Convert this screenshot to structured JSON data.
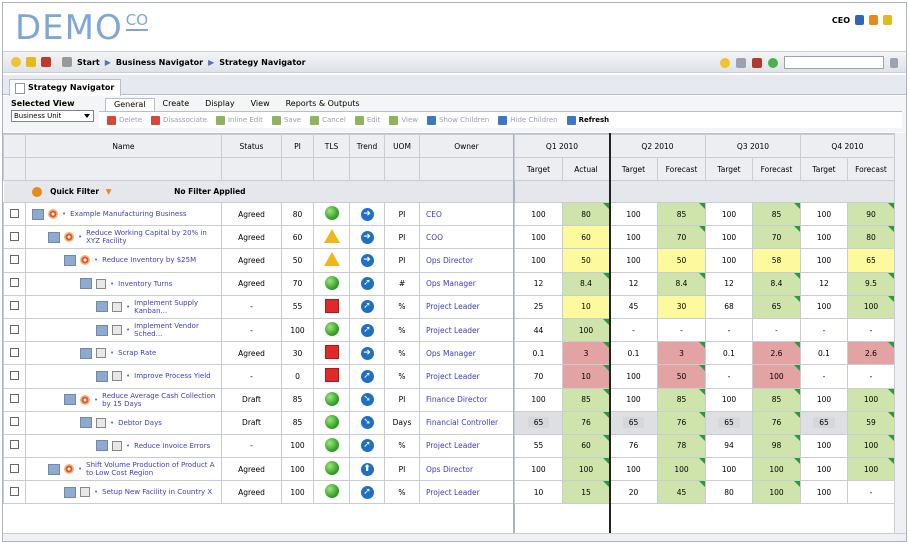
{
  "logo": {
    "main": "DEMO",
    "sub": "CO"
  },
  "user": {
    "name": "CEO",
    "icon_colors": [
      "#2e66b5",
      "#e58a1c",
      "#e5b81c"
    ]
  },
  "nav": {
    "start": "Start",
    "crumbs": [
      "Business Navigator",
      "Strategy Navigator"
    ]
  },
  "tab": {
    "label": "Strategy Navigator"
  },
  "view": {
    "label": "Selected View",
    "value": "Business Unit"
  },
  "menu": [
    "General",
    "Create",
    "Display",
    "View",
    "Reports & Outputs"
  ],
  "actions": [
    {
      "label": "Delete",
      "enabled": false,
      "color": "#d34a3d"
    },
    {
      "label": "Disassociate",
      "enabled": false,
      "color": "#d34a3d"
    },
    {
      "label": "Inline Edit",
      "enabled": false,
      "color": "#8fb45e"
    },
    {
      "label": "Save",
      "enabled": false,
      "color": "#8fb45e"
    },
    {
      "label": "Cancel",
      "enabled": false,
      "color": "#8fb45e"
    },
    {
      "label": "Edit",
      "enabled": false,
      "color": "#8fb45e"
    },
    {
      "label": "View",
      "enabled": false,
      "color": "#8fb45e"
    },
    {
      "label": "Show Children",
      "enabled": false,
      "color": "#3d78c7"
    },
    {
      "label": "Hide Children",
      "enabled": false,
      "color": "#3d78c7"
    },
    {
      "label": "Refresh",
      "enabled": true,
      "color": "#3d78c7"
    }
  ],
  "columns": [
    "Name",
    "Status",
    "PI",
    "TLS",
    "Trend",
    "UOM",
    "Owner"
  ],
  "filter": {
    "label": "Quick Filter",
    "status": "No Filter Applied"
  },
  "quarters": [
    "Q1 2010",
    "Q2 2010",
    "Q3 2010",
    "Q4 2010"
  ],
  "subheaders": [
    "Target",
    "Actual",
    "Target",
    "Forecast",
    "Target",
    "Forecast",
    "Target",
    "Forecast"
  ],
  "rows": [
    {
      "name": "Example Manufacturing Business",
      "depth": 0,
      "kind": "obj",
      "status": "Agreed",
      "pi": "80",
      "tls": "green",
      "trend": "right",
      "uom": "PI",
      "owner": "CEO",
      "vals": [
        [
          "100",
          ""
        ],
        [
          "80",
          "g"
        ],
        [
          "100",
          ""
        ],
        [
          "85",
          "g"
        ],
        [
          "100",
          ""
        ],
        [
          "85",
          "g"
        ],
        [
          "100",
          ""
        ],
        [
          "90",
          "g"
        ]
      ]
    },
    {
      "name": "Reduce Working Capital by 20% in XYZ Facility",
      "depth": 1,
      "kind": "obj",
      "status": "Agreed",
      "pi": "60",
      "tls": "warn",
      "trend": "right",
      "uom": "PI",
      "owner": "COO",
      "vals": [
        [
          "100",
          ""
        ],
        [
          "60",
          "y"
        ],
        [
          "100",
          ""
        ],
        [
          "70",
          "g"
        ],
        [
          "100",
          ""
        ],
        [
          "70",
          "g"
        ],
        [
          "100",
          ""
        ],
        [
          "80",
          "g"
        ]
      ]
    },
    {
      "name": "Reduce Inventory by $25M",
      "depth": 2,
      "kind": "obj",
      "status": "Agreed",
      "pi": "50",
      "tls": "warn",
      "trend": "right",
      "uom": "PI",
      "owner": "Ops Director",
      "vals": [
        [
          "100",
          ""
        ],
        [
          "50",
          "y"
        ],
        [
          "100",
          ""
        ],
        [
          "50",
          "y"
        ],
        [
          "100",
          ""
        ],
        [
          "58",
          "y"
        ],
        [
          "100",
          ""
        ],
        [
          "65",
          "y"
        ]
      ]
    },
    {
      "name": "Inventory Turns",
      "depth": 3,
      "kind": "kpi",
      "status": "Agreed",
      "pi": "70",
      "tls": "green",
      "trend": "up",
      "uom": "#",
      "owner": "Ops Manager",
      "vals": [
        [
          "12",
          ""
        ],
        [
          "8.4",
          "g"
        ],
        [
          "12",
          ""
        ],
        [
          "8.4",
          "g"
        ],
        [
          "12",
          ""
        ],
        [
          "8.4",
          "g"
        ],
        [
          "12",
          ""
        ],
        [
          "9.5",
          "g"
        ]
      ]
    },
    {
      "name": "Implement Supply Kanban...",
      "depth": 4,
      "kind": "kpi",
      "status": "-",
      "pi": "55",
      "tls": "red",
      "trend": "up",
      "uom": "%",
      "owner": "Project Leader",
      "vals": [
        [
          "25",
          ""
        ],
        [
          "10",
          "y"
        ],
        [
          "45",
          ""
        ],
        [
          "30",
          "y"
        ],
        [
          "68",
          ""
        ],
        [
          "65",
          "g"
        ],
        [
          "100",
          ""
        ],
        [
          "100",
          "g"
        ]
      ]
    },
    {
      "name": "Implement Vendor Sched...",
      "depth": 4,
      "kind": "kpi",
      "status": "-",
      "pi": "100",
      "tls": "green",
      "trend": "up",
      "uom": "%",
      "owner": "Project Leader",
      "vals": [
        [
          "44",
          ""
        ],
        [
          "100",
          "g"
        ],
        [
          "-",
          ""
        ],
        [
          "-",
          ""
        ],
        [
          "-",
          ""
        ],
        [
          "-",
          ""
        ],
        [
          "-",
          ""
        ],
        [
          "-",
          ""
        ]
      ]
    },
    {
      "name": "Scrap Rate",
      "depth": 3,
      "kind": "kpi",
      "status": "Agreed",
      "pi": "30",
      "tls": "red",
      "trend": "right",
      "uom": "%",
      "owner": "Ops Manager",
      "vals": [
        [
          "0.1",
          ""
        ],
        [
          "3",
          "r"
        ],
        [
          "0.1",
          ""
        ],
        [
          "3",
          "r"
        ],
        [
          "0.1",
          ""
        ],
        [
          "2.6",
          "r"
        ],
        [
          "0.1",
          ""
        ],
        [
          "2.6",
          "r"
        ]
      ]
    },
    {
      "name": "Improve Process Yield",
      "depth": 4,
      "kind": "kpi",
      "status": "-",
      "pi": "0",
      "tls": "red",
      "trend": "up",
      "uom": "%",
      "owner": "Project Leader",
      "vals": [
        [
          "70",
          ""
        ],
        [
          "10",
          "r"
        ],
        [
          "100",
          ""
        ],
        [
          "50",
          "r"
        ],
        [
          "-",
          ""
        ],
        [
          "100",
          "r"
        ],
        [
          "-",
          ""
        ],
        [
          "-",
          ""
        ]
      ]
    },
    {
      "name": "Reduce Average Cash Collection by 15 Days",
      "depth": 2,
      "kind": "obj",
      "status": "Draft",
      "pi": "85",
      "tls": "green",
      "trend": "down",
      "uom": "PI",
      "owner": "Finance Director",
      "vals": [
        [
          "100",
          ""
        ],
        [
          "85",
          "g"
        ],
        [
          "100",
          ""
        ],
        [
          "85",
          "g"
        ],
        [
          "100",
          ""
        ],
        [
          "85",
          "g"
        ],
        [
          "100",
          ""
        ],
        [
          "100",
          "g"
        ]
      ]
    },
    {
      "name": "Debtor Days",
      "depth": 3,
      "kind": "kpi",
      "status": "Draft",
      "pi": "85",
      "tls": "green",
      "trend": "down",
      "uom": "Days",
      "owner": "Financial Controller",
      "vals": [
        [
          "65",
          "gr"
        ],
        [
          "76",
          "g"
        ],
        [
          "65",
          "gr"
        ],
        [
          "76",
          "g"
        ],
        [
          "65",
          "gr"
        ],
        [
          "76",
          "g"
        ],
        [
          "65",
          "gr"
        ],
        [
          "59",
          "g"
        ]
      ]
    },
    {
      "name": "Reduce Invoice Errors",
      "depth": 4,
      "kind": "kpi",
      "status": "-",
      "pi": "100",
      "tls": "green",
      "trend": "up",
      "uom": "%",
      "owner": "Project Leader",
      "vals": [
        [
          "55",
          ""
        ],
        [
          "60",
          "g"
        ],
        [
          "76",
          ""
        ],
        [
          "78",
          "g"
        ],
        [
          "94",
          ""
        ],
        [
          "98",
          "g"
        ],
        [
          "100",
          ""
        ],
        [
          "100",
          "g"
        ]
      ]
    },
    {
      "name": "Shift Volume Production of Product A to Low Cost Region",
      "depth": 1,
      "kind": "obj",
      "status": "Agreed",
      "pi": "100",
      "tls": "green",
      "trend": "up2",
      "uom": "PI",
      "owner": "Ops Director",
      "vals": [
        [
          "100",
          ""
        ],
        [
          "100",
          "g"
        ],
        [
          "100",
          ""
        ],
        [
          "100",
          "g"
        ],
        [
          "100",
          ""
        ],
        [
          "100",
          "g"
        ],
        [
          "100",
          ""
        ],
        [
          "100",
          "g"
        ]
      ]
    },
    {
      "name": "Setup New Facility in Country X",
      "depth": 2,
      "kind": "kpi",
      "status": "Agreed",
      "pi": "100",
      "tls": "green",
      "trend": "up",
      "uom": "%",
      "owner": "Project Leader",
      "vals": [
        [
          "10",
          ""
        ],
        [
          "15",
          "g"
        ],
        [
          "20",
          ""
        ],
        [
          "45",
          "g"
        ],
        [
          "80",
          ""
        ],
        [
          "100",
          "g"
        ],
        [
          "100",
          ""
        ],
        [
          "-",
          ""
        ]
      ]
    }
  ]
}
